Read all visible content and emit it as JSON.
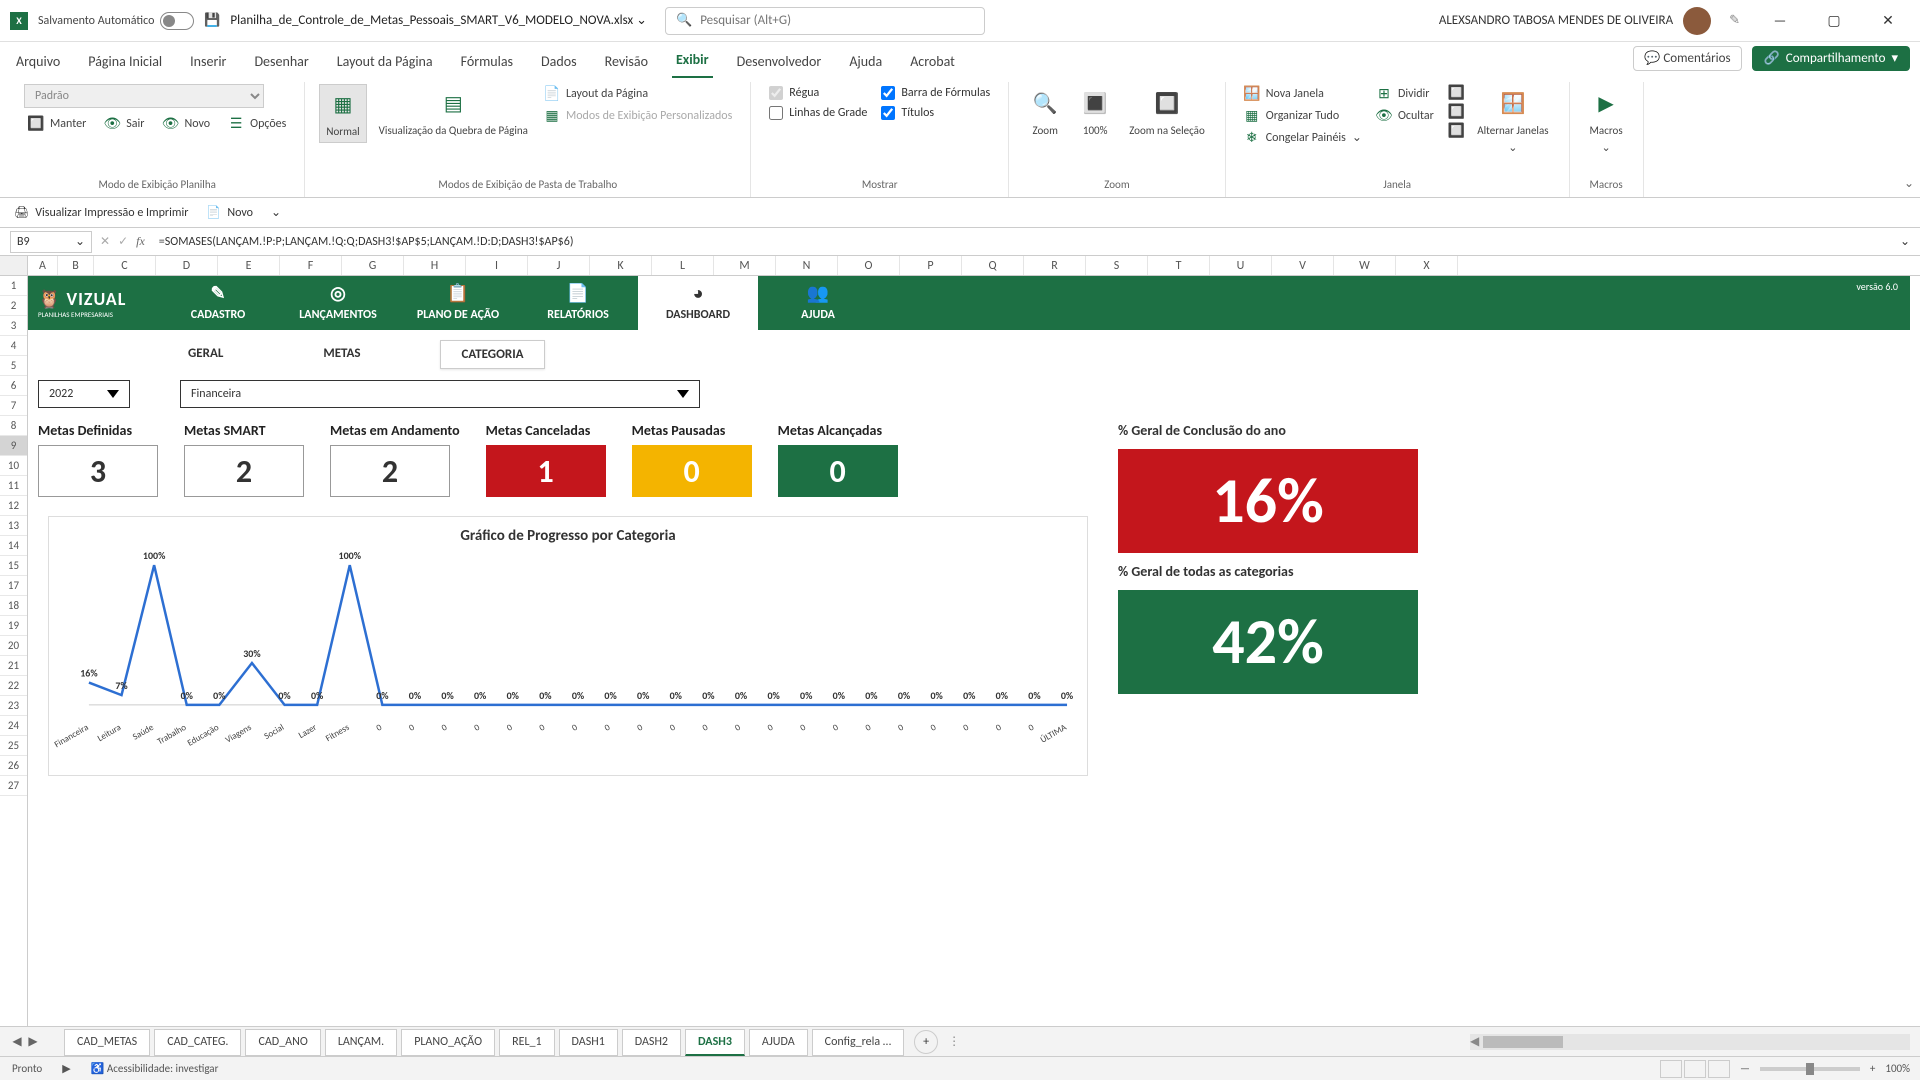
{
  "titlebar": {
    "app": "X",
    "autosave": "Salvamento Automático",
    "filename": "Planilha_de_Controle_de_Metas_Pessoais_SMART_V6_MODELO_NOVA.xlsx",
    "search_placeholder": "Pesquisar (Alt+G)",
    "username": "ALEXSANDRO TABOSA MENDES DE OLIVEIRA"
  },
  "menu": {
    "tabs": [
      "Arquivo",
      "Página Inicial",
      "Inserir",
      "Desenhar",
      "Layout da Página",
      "Fórmulas",
      "Dados",
      "Revisão",
      "Exibir",
      "Desenvolvedor",
      "Ajuda",
      "Acrobat"
    ],
    "active": "Exibir",
    "comments": "Comentários",
    "share": "Compartilhamento"
  },
  "ribbon": {
    "group1_label": "Modo de Exibição Planilha",
    "padrao": "Padrão",
    "manter": "Manter",
    "sair": "Sair",
    "novo": "Novo",
    "opcoes": "Opções",
    "group2_label": "Modos de Exibição de Pasta de Trabalho",
    "normal": "Normal",
    "quebra": "Visualização da Quebra de Página",
    "layout": "Layout da Página",
    "pers": "Modos de Exibição Personalizados",
    "group3_label": "Mostrar",
    "regua": "Régua",
    "barra": "Barra de Fórmulas",
    "linhas": "Linhas de Grade",
    "titulos": "Títulos",
    "group4_label": "Zoom",
    "zoom": "Zoom",
    "z100": "100%",
    "zsel": "Zoom na Seleção",
    "group5_label": "Janela",
    "nova": "Nova Janela",
    "org": "Organizar Tudo",
    "cong": "Congelar Painéis",
    "div": "Dividir",
    "ocu": "Ocultar",
    "alt": "Alternar Janelas",
    "group6_label": "Macros",
    "macros": "Macros"
  },
  "qat": {
    "preview": "Visualizar Impressão e Imprimir",
    "novo": "Novo"
  },
  "fbar": {
    "cell": "B9",
    "formula": "=SOMASES(LANÇAM.!P:P;LANÇAM.!Q:Q;DASH3!$AP$5;LANÇAM.!D:D;DASH3!$AP$6)"
  },
  "columns": [
    "A",
    "B",
    "C",
    "D",
    "E",
    "F",
    "G",
    "H",
    "I",
    "J",
    "K",
    "L",
    "M",
    "N",
    "O",
    "P",
    "Q",
    "R",
    "S",
    "T",
    "U",
    "V",
    "W",
    "X"
  ],
  "rows": [
    "1",
    "2",
    "3",
    "4",
    "5",
    "6",
    "7",
    "8",
    "9",
    "10",
    "11",
    "12",
    "13",
    "14",
    "15",
    "17",
    "18",
    "19",
    "20",
    "21",
    "22",
    "23",
    "24",
    "25",
    "26",
    "27"
  ],
  "dashribbon": {
    "logo": "VIZUAL",
    "logosub": "PLANILHAS EMPRESARIAIS",
    "tabs": [
      "CADASTRO",
      "LANÇAMENTOS",
      "PLANO DE AÇÃO",
      "RELATÓRIOS",
      "DASHBOARD",
      "AJUDA"
    ],
    "active": "DASHBOARD",
    "version": "versão 6.0"
  },
  "subtabs": {
    "items": [
      "GERAL",
      "METAS",
      "CATEGORIA"
    ],
    "active": "CATEGORIA"
  },
  "filters": {
    "year": "2022",
    "category": "Financeira"
  },
  "kpis": [
    {
      "title": "Metas Definidas",
      "value": "3",
      "class": ""
    },
    {
      "title": "Metas SMART",
      "value": "2",
      "class": ""
    },
    {
      "title": "Metas em Andamento",
      "value": "2",
      "class": ""
    },
    {
      "title": "Metas Canceladas",
      "value": "1",
      "class": "red"
    },
    {
      "title": "Metas Pausadas",
      "value": "0",
      "class": "yellow"
    },
    {
      "title": "Metas Alcançadas",
      "value": "0",
      "class": "green"
    }
  ],
  "bigcards": {
    "title1": "% Geral de Conclusão do ano",
    "value1": "16%",
    "title2": "% Geral de todas as categorias",
    "value2": "42%"
  },
  "chart_data": {
    "type": "line",
    "title": "Gráfico de Progresso por Categoria",
    "ylim": [
      0,
      100
    ],
    "categories": [
      "Financeira",
      "Leitura",
      "Saúde",
      "Trabalho",
      "Educação",
      "Viagens",
      "Social",
      "Lazer",
      "Fitness",
      "0",
      "0",
      "0",
      "0",
      "0",
      "0",
      "0",
      "0",
      "0",
      "0",
      "0",
      "0",
      "0",
      "0",
      "0",
      "0",
      "0",
      "0",
      "0",
      "0",
      "0",
      "ÚLTIMA"
    ],
    "values": [
      16,
      7,
      100,
      0,
      0,
      30,
      0,
      0,
      100,
      0,
      0,
      0,
      0,
      0,
      0,
      0,
      0,
      0,
      0,
      0,
      0,
      0,
      0,
      0,
      0,
      0,
      0,
      0,
      0,
      0,
      0
    ],
    "labels": [
      "16%",
      "7%",
      "100%",
      "0%",
      "0%",
      "30%",
      "0%",
      "0%",
      "100%",
      "0%",
      "0%",
      "0%",
      "0%",
      "0%",
      "0%",
      "0%",
      "0%",
      "0%",
      "0%",
      "0%",
      "0%",
      "0%",
      "0%",
      "0%",
      "0%",
      "0%",
      "0%",
      "0%",
      "0%",
      "0%",
      "0%"
    ]
  },
  "sheettabs": {
    "tabs": [
      "CAD_METAS",
      "CAD_CATEG.",
      "CAD_ANO",
      "LANÇAM.",
      "PLANO_AÇÃO",
      "REL_1",
      "DASH1",
      "DASH2",
      "DASH3",
      "AJUDA",
      "Config_rela …"
    ],
    "active": "DASH3"
  },
  "status": {
    "ready": "Pronto",
    "access": "Acessibilidade: investigar",
    "zoom": "100%"
  }
}
